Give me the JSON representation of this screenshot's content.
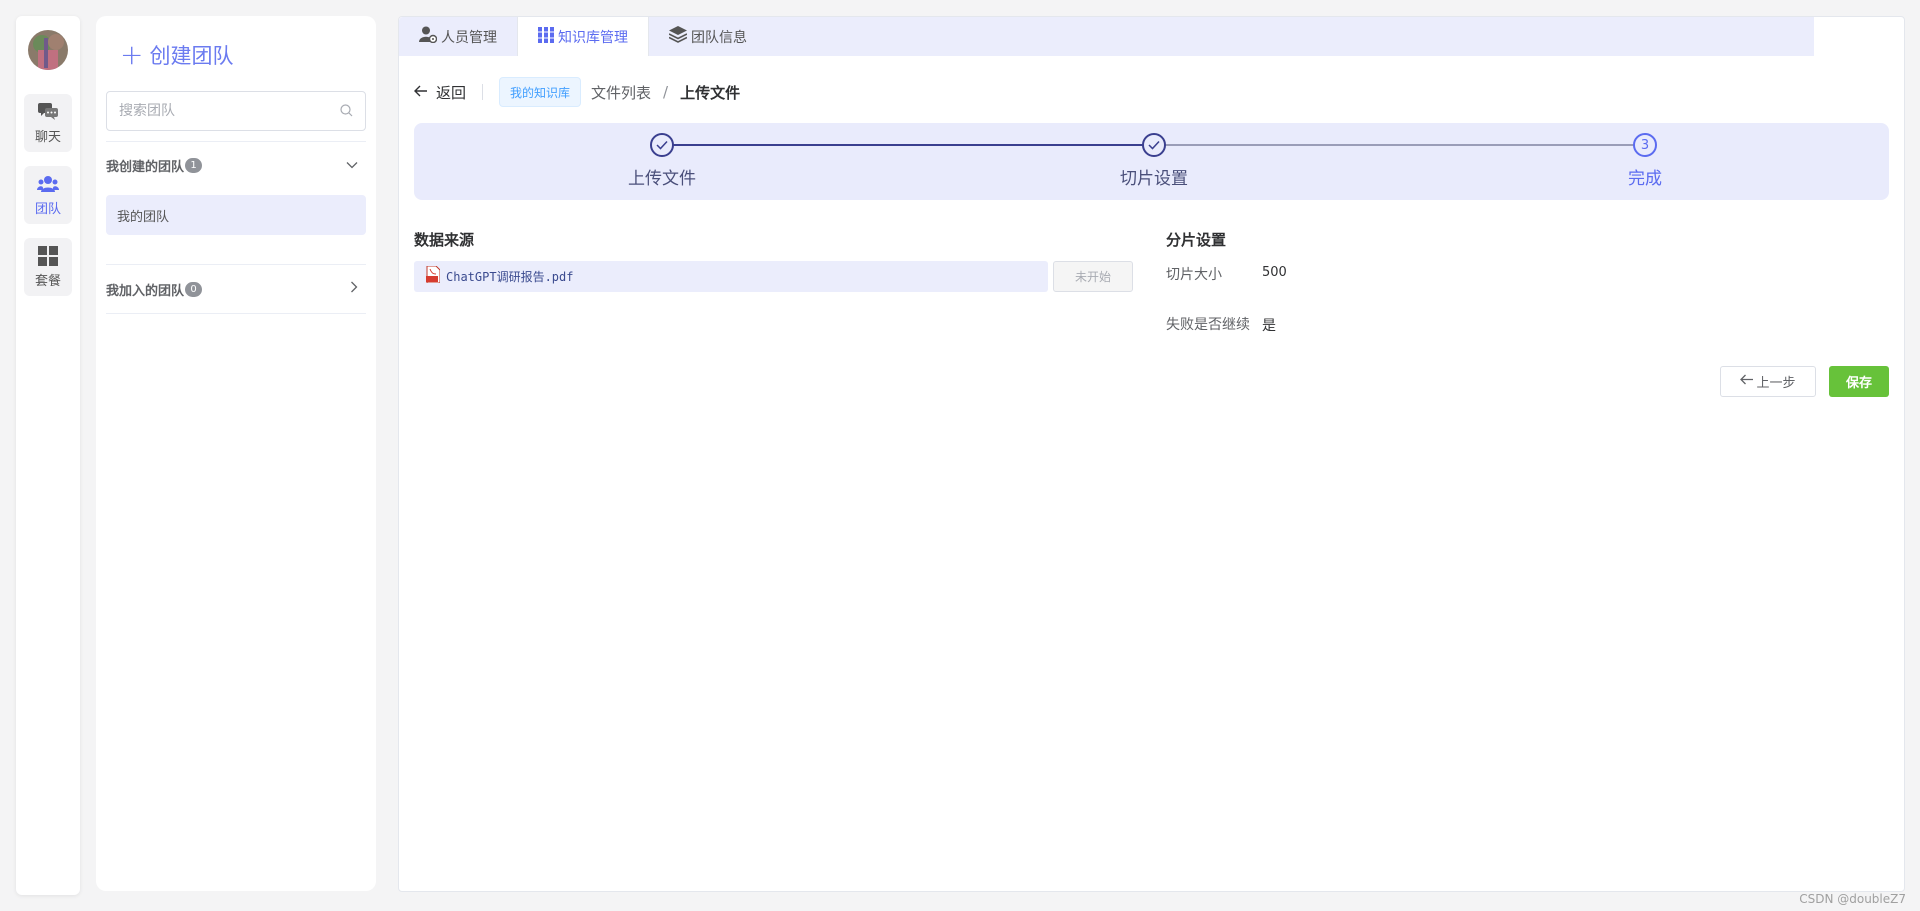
{
  "sidebar": {
    "items": [
      {
        "label": "聊天",
        "icon": "chat-icon"
      },
      {
        "label": "团队",
        "icon": "team-icon"
      },
      {
        "label": "套餐",
        "icon": "grid-icon"
      }
    ]
  },
  "team_panel": {
    "create_label": "创建团队",
    "search_placeholder": "搜索团队",
    "created_group": {
      "label": "我创建的团队",
      "count": "1"
    },
    "created_teams": [
      "我的团队"
    ],
    "joined_group": {
      "label": "我加入的团队",
      "count": "0"
    }
  },
  "tabs": [
    {
      "label": "人员管理",
      "icon": "user-settings-icon"
    },
    {
      "label": "知识库管理",
      "icon": "library-icon"
    },
    {
      "label": "团队信息",
      "icon": "layers-icon"
    }
  ],
  "breadcrumb": {
    "back": "返回",
    "kb_tag": "我的知识库",
    "file_list": "文件列表",
    "separator": "/",
    "current": "上传文件"
  },
  "steps": [
    {
      "title": "上传文件",
      "status": "done"
    },
    {
      "title": "切片设置",
      "status": "done"
    },
    {
      "title": "完成",
      "status": "current",
      "number": "3"
    }
  ],
  "data_source": {
    "title": "数据来源",
    "file_name": "ChatGPT调研报告.pdf",
    "status": "未开始"
  },
  "chunk_settings": {
    "title": "分片设置",
    "size_label": "切片大小",
    "size_value": "500",
    "continue_label": "失败是否继续",
    "continue_value": "是"
  },
  "actions": {
    "prev": "上一步",
    "save": "保存"
  },
  "watermark": "CSDN @doubleZ7",
  "colors": {
    "accent": "#5b6bf0",
    "tab_bar": "#ebedfc",
    "save_green": "#67c23a",
    "step_done": "#3a3f8f"
  }
}
